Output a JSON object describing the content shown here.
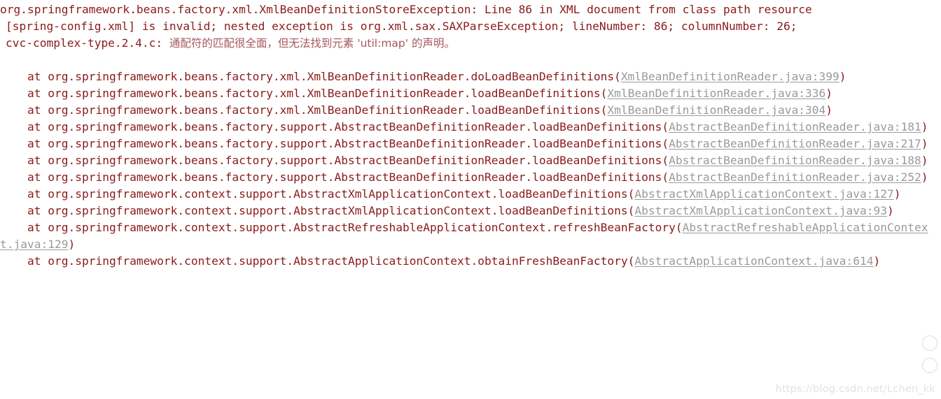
{
  "console": {
    "background_color": "#ffffff",
    "text_color": "#8b1a1a",
    "link_color": "#9a9a9a",
    "cjk_text_color": "#a6575c",
    "watermark_color": "#e2e2e2"
  },
  "exception": {
    "header_segments": [
      "org.springframework.beans.factory.xml.XmlBeanDefinitionStoreException: Line 86 in XML document from class path resource",
      "[spring-config.xml] is invalid; nested exception is org.xml.sax.SAXParseException; lineNumber: 86; columnNumber: 26;",
      "cvc-complex-type.2.4.c: "
    ],
    "header_cjk": "通配符的匹配很全面，但无法找到元素 'util:map' 的声明。",
    "class_name": "org.springframework.beans.factory.xml.XmlBeanDefinitionStoreException",
    "line": "86",
    "resource": "spring-config.xml",
    "nested_exception": "org.xml.sax.SAXParseException",
    "line_number": "86",
    "column_number": "26",
    "error_code": "cvc-complex-type.2.4.c",
    "missing_element": "util:map"
  },
  "frames": [
    {
      "at": "    at ",
      "method": "org.springframework.beans.factory.xml.XmlBeanDefinitionReader.doLoadBeanDefinitions",
      "open": "(",
      "source": "XmlBeanDefinitionReader.java:399",
      "close": ")"
    },
    {
      "at": "    at ",
      "method": "org.springframework.beans.factory.xml.XmlBeanDefinitionReader.loadBeanDefinitions",
      "open": "(",
      "source": "XmlBeanDefinitionReader.java:336",
      "close": ")"
    },
    {
      "at": "    at ",
      "method": "org.springframework.beans.factory.xml.XmlBeanDefinitionReader.loadBeanDefinitions",
      "open": "(",
      "source": "XmlBeanDefinitionReader.java:304",
      "close": ")"
    },
    {
      "at": "    at ",
      "method": "org.springframework.beans.factory.support.AbstractBeanDefinitionReader.loadBeanDefinitions",
      "open": "(",
      "source": "AbstractBeanDefinitionReader.java:181",
      "close": ")"
    },
    {
      "at": "    at ",
      "method": "org.springframework.beans.factory.support.AbstractBeanDefinitionReader.loadBeanDefinitions",
      "open": "(",
      "source": "AbstractBeanDefinitionReader.java:217",
      "close": ")"
    },
    {
      "at": "    at ",
      "method": "org.springframework.beans.factory.support.AbstractBeanDefinitionReader.loadBeanDefinitions",
      "open": "(",
      "source": "AbstractBeanDefinitionReader.java:188",
      "close": ")"
    },
    {
      "at": "    at ",
      "method": "org.springframework.beans.factory.support.AbstractBeanDefinitionReader.loadBeanDefinitions",
      "open": "(",
      "source": "AbstractBeanDefinitionReader.java:252",
      "close": ")"
    },
    {
      "at": "    at ",
      "method": "org.springframework.context.support.AbstractXmlApplicationContext.loadBeanDefinitions",
      "open": "(",
      "source": "AbstractXmlApplicationContext.java:127",
      "close": ")"
    },
    {
      "at": "    at ",
      "method": "org.springframework.context.support.AbstractXmlApplicationContext.loadBeanDefinitions",
      "open": "(",
      "source": "AbstractXmlApplicationContext.java:93",
      "close": ")"
    },
    {
      "at": "    at ",
      "method": "org.springframework.context.support.AbstractRefreshableApplicationContext.refreshBeanFactory",
      "open": "(",
      "source": "AbstractRefreshableApplicationContext.java:129",
      "close": ")"
    },
    {
      "at": "    at ",
      "method": "org.springframework.context.support.AbstractApplicationContext.obtainFreshBeanFactory",
      "open": "(",
      "source": "AbstractApplicationContext.java:614",
      "close": ")"
    }
  ],
  "watermark": {
    "text": "https://blog.csdn.net/Lchen_kk"
  }
}
